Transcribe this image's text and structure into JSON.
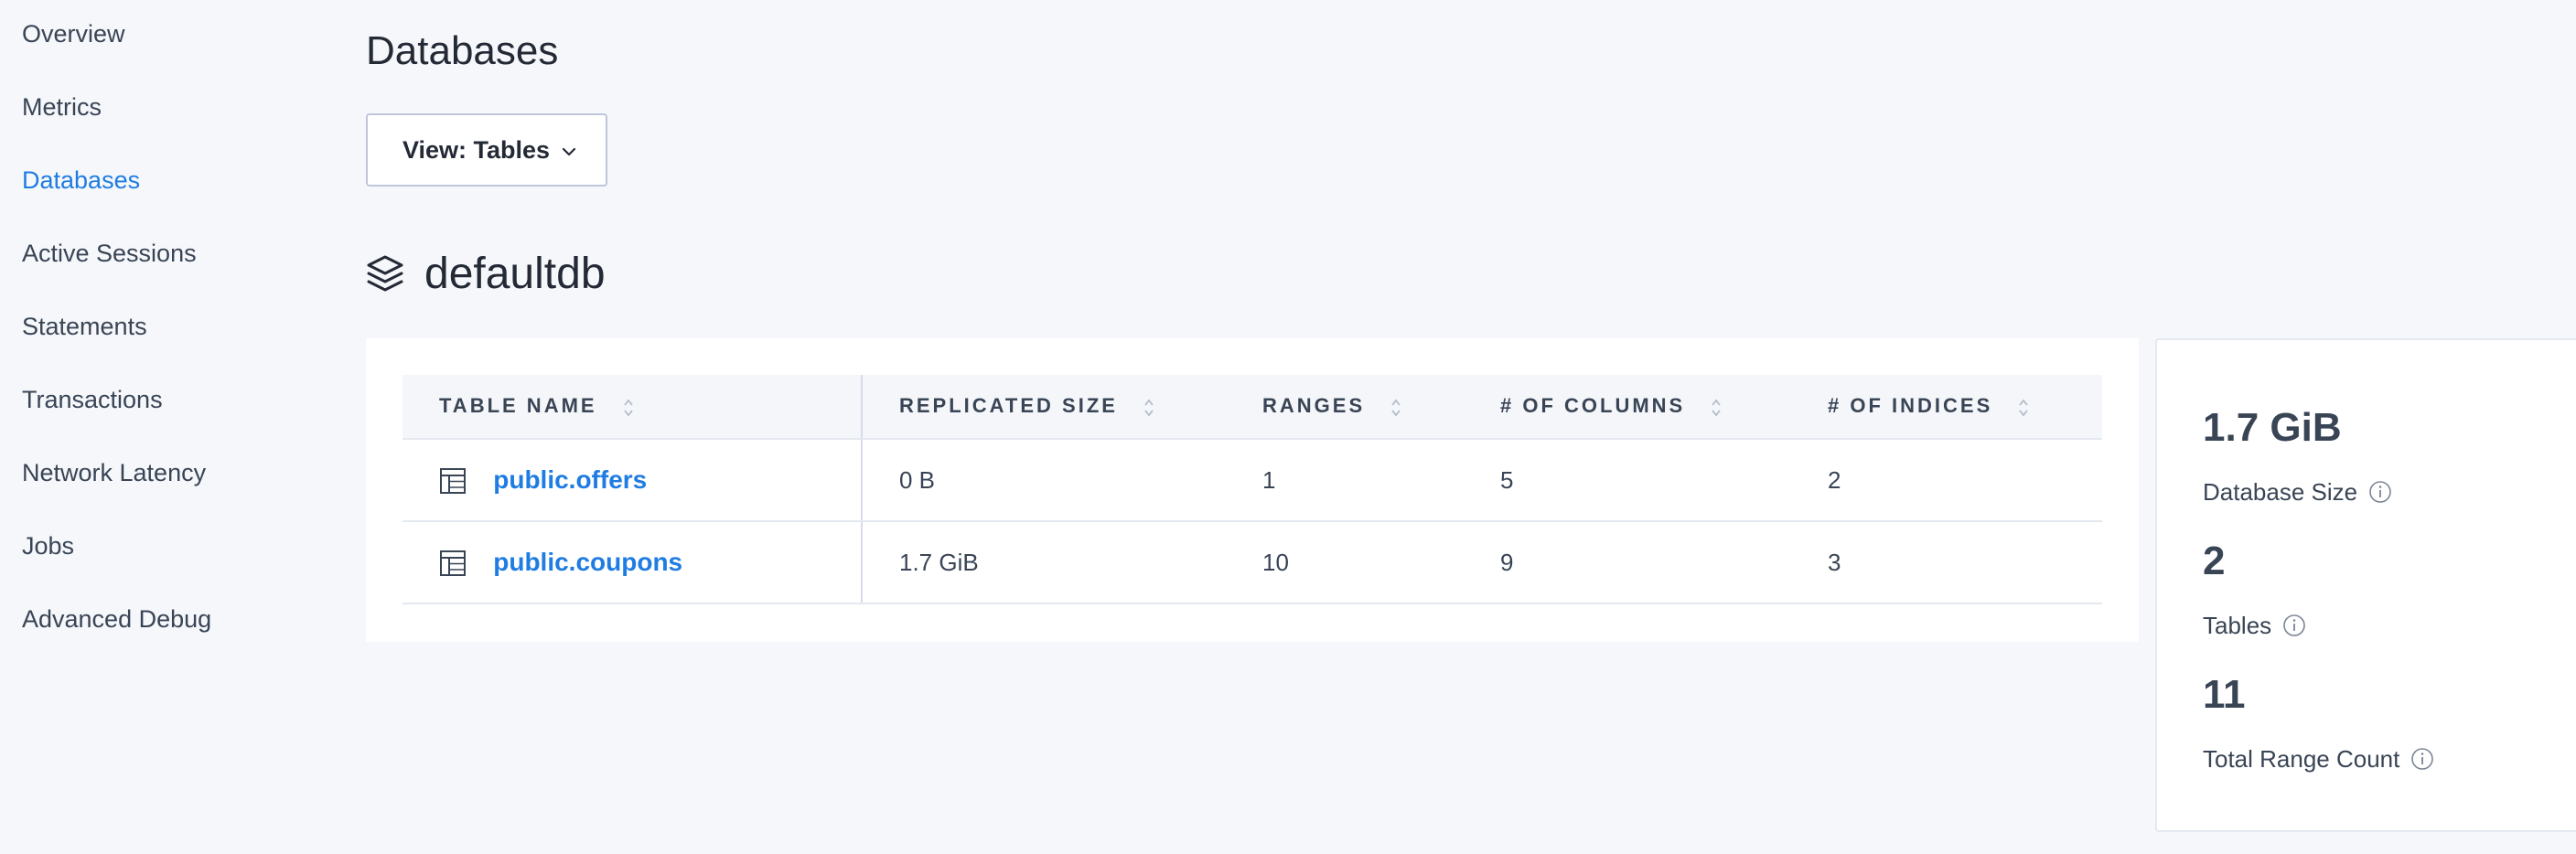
{
  "sidebar": {
    "items": [
      {
        "label": "Overview",
        "active": false
      },
      {
        "label": "Metrics",
        "active": false
      },
      {
        "label": "Databases",
        "active": true
      },
      {
        "label": "Active Sessions",
        "active": false
      },
      {
        "label": "Statements",
        "active": false
      },
      {
        "label": "Transactions",
        "active": false
      },
      {
        "label": "Network Latency",
        "active": false
      },
      {
        "label": "Jobs",
        "active": false
      },
      {
        "label": "Advanced Debug",
        "active": false
      }
    ]
  },
  "main": {
    "title": "Databases",
    "view_dropdown": {
      "label": "View: Tables",
      "icon": "chevron-down-icon"
    },
    "database": {
      "name": "defaultdb",
      "icon": "stack-icon",
      "table": {
        "columns": [
          "TABLE NAME",
          "REPLICATED SIZE",
          "RANGES",
          "# OF COLUMNS",
          "# OF INDICES"
        ],
        "rows": [
          {
            "name": "public.offers",
            "replicated_size": "0 B",
            "ranges": "1",
            "columns": "5",
            "indices": "2"
          },
          {
            "name": "public.coupons",
            "replicated_size": "1.7 GiB",
            "ranges": "10",
            "columns": "9",
            "indices": "3"
          }
        ]
      }
    }
  },
  "summary": {
    "database_size": {
      "value": "1.7 GiB",
      "label": "Database Size"
    },
    "tables": {
      "value": "2",
      "label": "Tables"
    },
    "range_count": {
      "value": "11",
      "label": "Total Range Count"
    }
  },
  "colors": {
    "accent": "#1f7ce2",
    "text": "#394455",
    "background": "#f5f7fa"
  }
}
